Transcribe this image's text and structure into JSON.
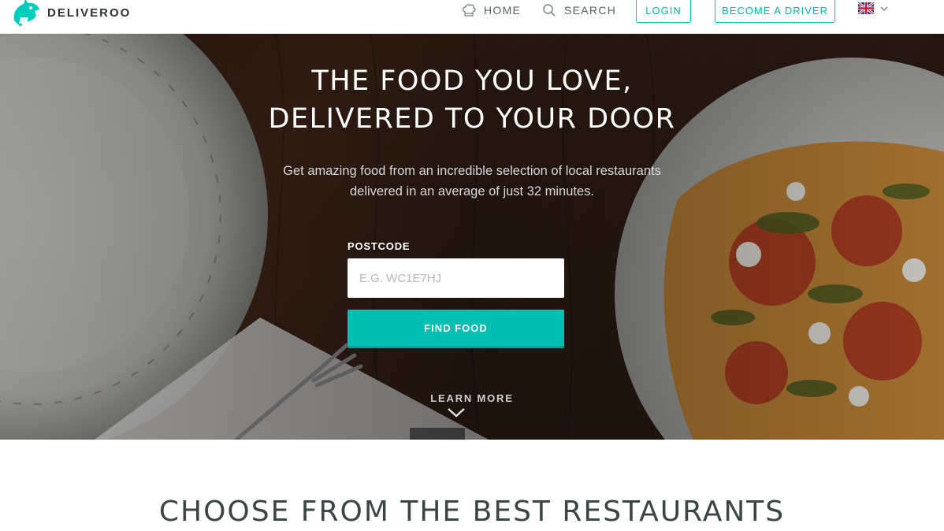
{
  "header": {
    "brand": "DELIVEROO",
    "nav": {
      "home_label": "HOME",
      "search_label": "SEARCH",
      "login_label": "LOGIN",
      "driver_label": "BECOME A DRIVER"
    },
    "language_icon": "uk-flag-icon"
  },
  "hero": {
    "title": "THE FOOD YOU LOVE,\nDELIVERED TO YOUR DOOR",
    "subtitle": "Get amazing food from an incredible selection of local restaurants\ndelivered in an average of just 32 minutes.",
    "postcode_label": "POSTCODE",
    "postcode_placeholder": "E.G. WC1E7HJ",
    "postcode_value": "",
    "find_button": "FIND FOOD",
    "learn_more": "LEARN MORE"
  },
  "restaurants": {
    "title": "CHOOSE FROM THE BEST RESTAURANTS"
  },
  "colors": {
    "accent": "#00ccbc",
    "button": "#00bfb1",
    "text_dark": "#2e3333"
  }
}
